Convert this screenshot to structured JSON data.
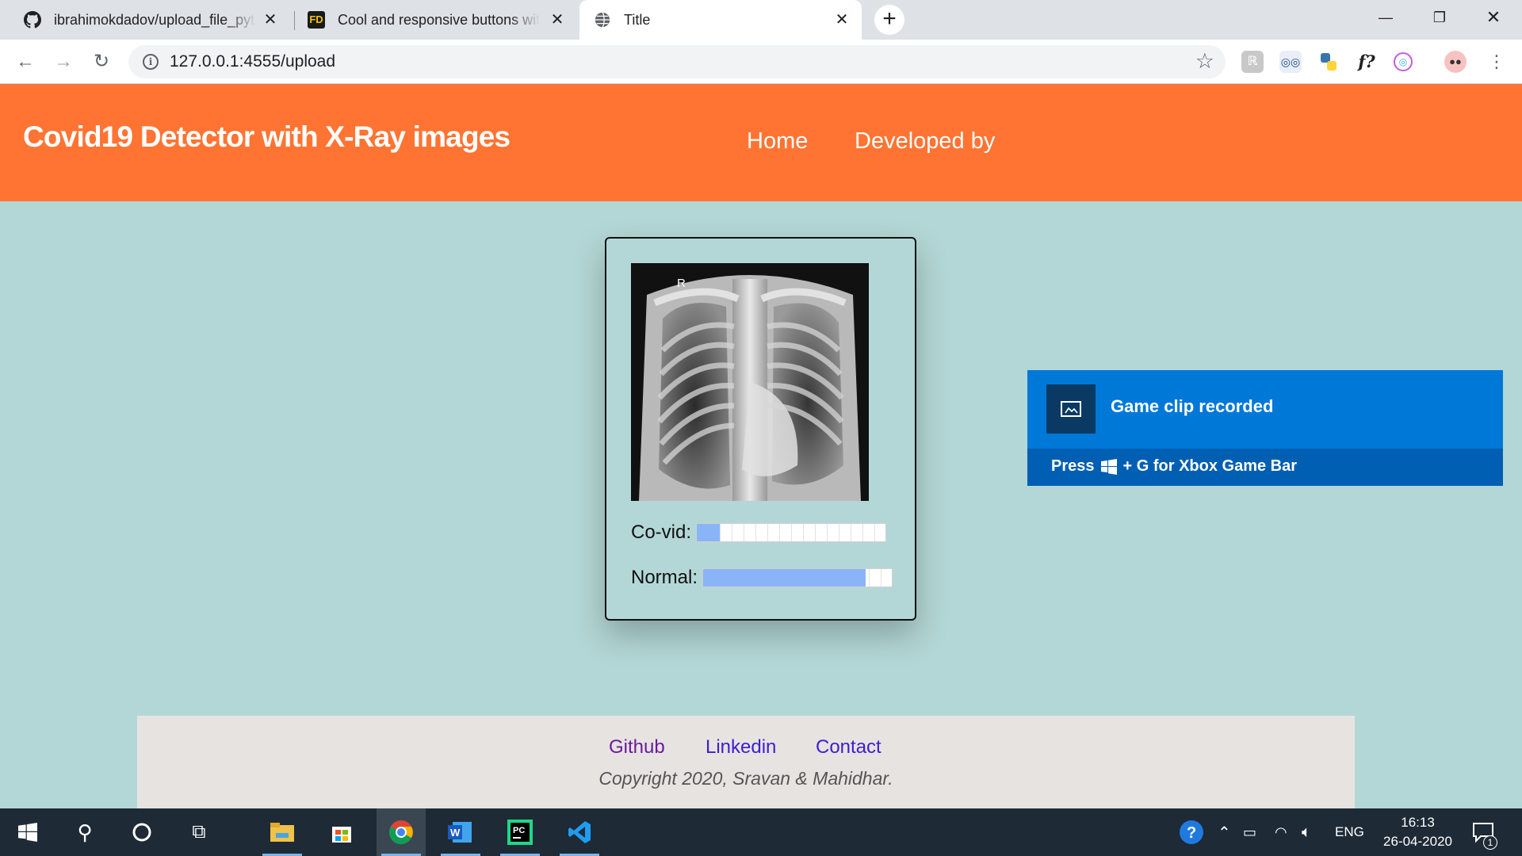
{
  "browser": {
    "tabs": [
      {
        "title": "ibrahimokdadov/upload_file_pyt",
        "favicon": "github-icon"
      },
      {
        "title": "Cool and responsive buttons wit",
        "favicon": "fd-icon",
        "favicon_text": "FD"
      },
      {
        "title": "Title",
        "favicon": "globe-icon"
      }
    ],
    "active_tab": 2,
    "new_tab": "+",
    "url": "127.0.0.1:4555/upload"
  },
  "header": {
    "title": "Covid19 Detector with X-Ray images",
    "nav": [
      "Home",
      "Developed by"
    ]
  },
  "result": {
    "image_marker": "R",
    "meters": [
      {
        "label": "Co-vid:",
        "value": 0.12
      },
      {
        "label": "Normal:",
        "value": 0.86
      }
    ]
  },
  "footer": {
    "links": [
      "Github",
      "Linkedin",
      "Contact"
    ],
    "copyright": "Copyright 2020, Sravan & Mahidhar."
  },
  "toast": {
    "title": "Game clip recorded",
    "hint_prefix": "Press",
    "hint_suffix": "+ G for Xbox Game Bar"
  },
  "taskbar": {
    "language": "ENG",
    "time": "16:13",
    "date": "26-04-2020",
    "notification_count": "1"
  },
  "colors": {
    "header_bg": "#ff7433",
    "page_bg": "#b3d7d6",
    "meter_fill": "#8ab4f8",
    "toast_blue": "#0078d7",
    "footer_link_visited": "#6a1b9a",
    "footer_link": "#3b1fcf"
  }
}
